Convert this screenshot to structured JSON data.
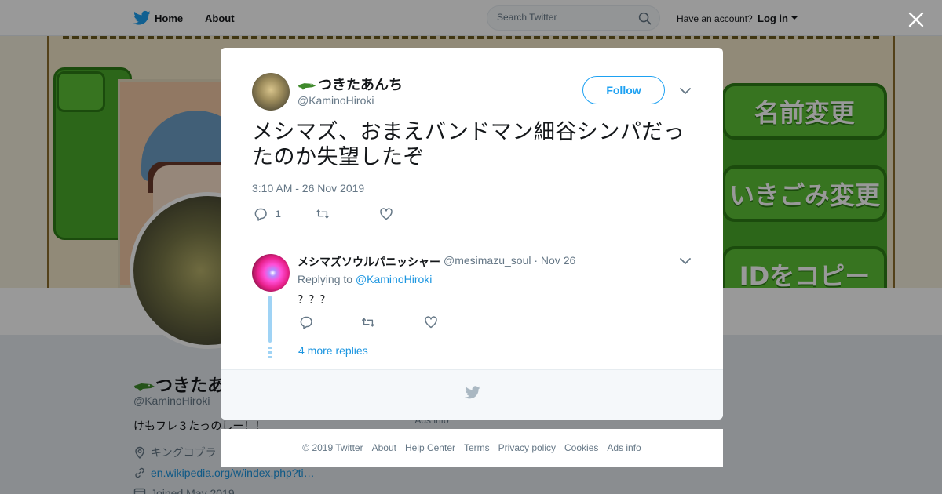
{
  "nav": {
    "home": "Home",
    "about": "About",
    "search_placeholder": "Search Twitter",
    "have_account": "Have an account?",
    "login": "Log in"
  },
  "banner": {
    "buttons": [
      "名前変更",
      "いきごみ変更",
      "IDをコピー"
    ]
  },
  "profile": {
    "name": "つきたあ",
    "handle": "@KaminoHiroki",
    "bio": "けもフレ３たっのしー！！",
    "location": "キングコブラ",
    "url": "en.wikipedia.org/w/index.php?ti…",
    "joined": "Joined May 2019",
    "ads_info": "Ads info"
  },
  "tweet": {
    "display_name": "つきたあんち",
    "handle": "@KaminoHiroki",
    "follow_label": "Follow",
    "text": "メシマズ、おまえバンドマン細谷シンパだったのか失望したぞ",
    "timestamp": "3:10 AM - 26 Nov 2019",
    "reply_count": "1"
  },
  "reply": {
    "display_name": "メシマズソウルパニッシャー",
    "meta": "@mesimazu_soul · Nov 26",
    "replying_prefix": "Replying to",
    "replying_to": "@KaminoHiroki",
    "text": "？？？",
    "more_replies": "4 more replies"
  },
  "footer": {
    "copyright": "© 2019 Twitter",
    "about": "About",
    "help": "Help Center",
    "terms": "Terms",
    "privacy": "Privacy policy",
    "cookies": "Cookies",
    "ads": "Ads info"
  },
  "colors": {
    "accent": "#1da1f2",
    "link": "#1b95e0",
    "secondary_text": "#657786",
    "banner_green": "#4aaa2a"
  },
  "icons": [
    "twitter-bird-icon",
    "search-icon",
    "caret-down-icon",
    "close-icon",
    "reply-icon",
    "retweet-icon",
    "like-icon",
    "chevron-down-icon",
    "location-icon",
    "link-icon",
    "calendar-icon",
    "crocodile-emoji"
  ]
}
